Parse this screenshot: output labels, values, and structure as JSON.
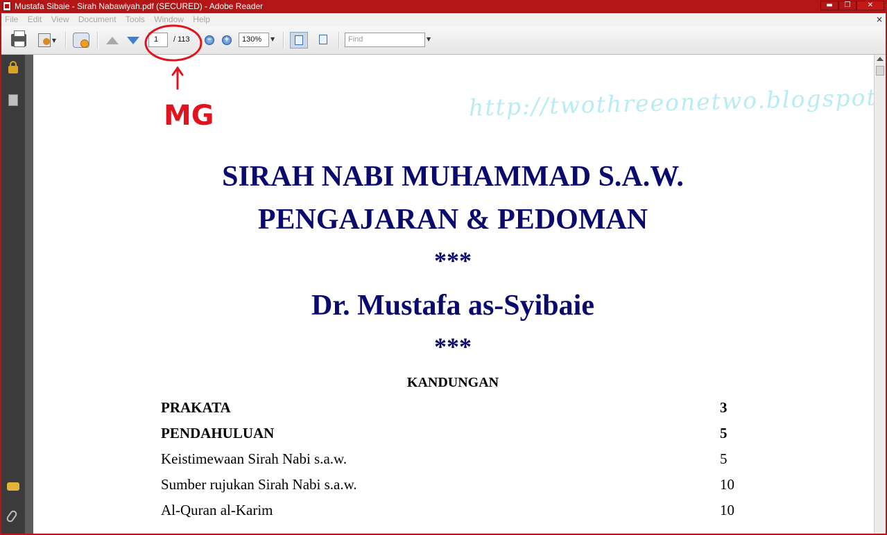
{
  "window": {
    "title": "Mustafa Sibaie - Sirah Nabawiyah.pdf (SECURED) - Adobe Reader",
    "controls": [
      "▬",
      "❐",
      "✕"
    ],
    "doc_close": "×"
  },
  "menu": [
    "File",
    "Edit",
    "View",
    "Document",
    "Tools",
    "Window",
    "Help"
  ],
  "toolbar": {
    "current_page": "1",
    "total_pages": "/ 113",
    "zoom_out_symbol": "−",
    "zoom_in_symbol": "+",
    "zoom": "130%",
    "find_placeholder": "Find"
  },
  "icons": {
    "nav": [
      "lock-icon",
      "pages-icon",
      "comment-icon",
      "attachment-icon"
    ],
    "toolbar": [
      "print-icon",
      "document-tools-icon",
      "collaborate-icon",
      "previous-page-icon",
      "next-page-icon",
      "zoom-out-icon",
      "zoom-in-icon",
      "fit-width-icon",
      "fit-page-icon"
    ]
  },
  "document": {
    "watermark": "http://twothreeonetwo.blogspot.com/",
    "title_line1": "SIRAH NABI MUHAMMAD S.A.W.",
    "title_line2": "PENGAJARAN & PEDOMAN",
    "separator": "***",
    "author": "Dr. Mustafa as-Syibaie",
    "toc_heading": "KANDUNGAN",
    "toc": [
      {
        "label": "PRAKATA",
        "page": "3",
        "bold": true
      },
      {
        "label": "PENDAHULUAN",
        "page": "5",
        "bold": true
      },
      {
        "label": "Keistimewaan Sirah Nabi s.a.w.",
        "page": "5",
        "bold": false
      },
      {
        "label": "Sumber rujukan Sirah Nabi s.a.w.",
        "page": "10",
        "bold": false
      },
      {
        "label": "Al-Quran al-Karim",
        "page": "10",
        "bold": false
      }
    ]
  },
  "annotation": {
    "text": "MG",
    "color": "#e0141e"
  },
  "colors": {
    "title_text": "#0a0a6e",
    "window_frame": "#b31616",
    "watermark": "#b7ecf2"
  }
}
